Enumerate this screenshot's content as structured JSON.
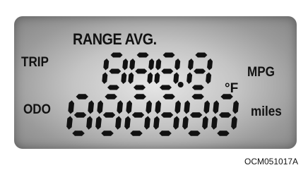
{
  "display": {
    "range_avg_label": "RANGE AVG.",
    "trip_label": "TRIP",
    "mpg_label": "MPG",
    "odo_label": "ODO",
    "miles_label": "miles",
    "temp_unit_label": "°F",
    "upper_value": "888.8",
    "lower_value": "888888"
  },
  "figure_code": "OCM051017A",
  "colors": {
    "segment": "#111111",
    "panel": "#c4c4c4"
  }
}
